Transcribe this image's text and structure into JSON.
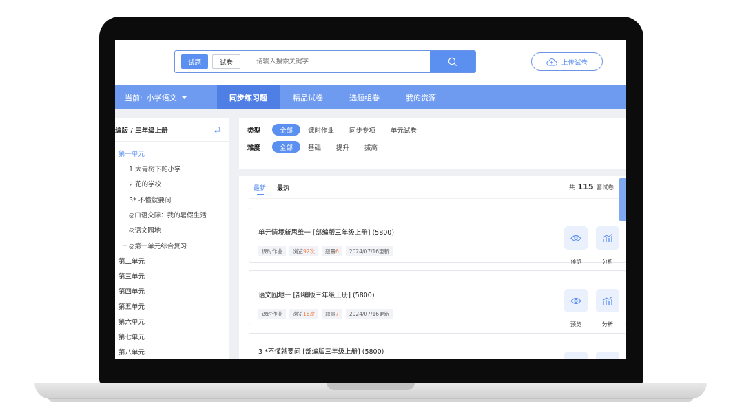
{
  "header": {
    "tabs": [
      {
        "label": "试题",
        "active": true
      },
      {
        "label": "试卷",
        "active": false
      }
    ],
    "search_placeholder": "请输入搜索关键字",
    "upload_label": "上传试卷"
  },
  "nav": {
    "current_prefix": "当前:",
    "current_subject": "小学语文",
    "tabs": [
      {
        "label": "同步练习题",
        "active": true
      },
      {
        "label": "精品试卷",
        "active": false
      },
      {
        "label": "选题组卷",
        "active": false
      },
      {
        "label": "我的资源",
        "active": false
      }
    ]
  },
  "sidebar": {
    "heading": "编版 / 三年级上册",
    "active_unit": "第一单元",
    "lessons": [
      "1 大青树下的小学",
      "2 花的学校",
      "3* 不懂就要问",
      "◎口语交际：我的暑假生活",
      "◎语文园地",
      "◎第一单元综合复习"
    ],
    "units": [
      "第二单元",
      "第三单元",
      "第四单元",
      "第五单元",
      "第六单元",
      "第七单元",
      "第八单元"
    ]
  },
  "filters": {
    "type_label": "类型",
    "types": [
      {
        "label": "全部",
        "active": true
      },
      {
        "label": "课时作业",
        "active": false
      },
      {
        "label": "同步专项",
        "active": false
      },
      {
        "label": "单元试卷",
        "active": false
      }
    ],
    "difficulty_label": "难度",
    "difficulties": [
      {
        "label": "全部",
        "active": true
      },
      {
        "label": "基础",
        "active": false
      },
      {
        "label": "提升",
        "active": false
      },
      {
        "label": "拔高",
        "active": false
      }
    ]
  },
  "results": {
    "sort_tabs": [
      {
        "label": "最新",
        "active": true
      },
      {
        "label": "最热",
        "active": false
      }
    ],
    "total_prefix": "共",
    "total_count": "115",
    "total_suffix": "套试卷",
    "preview_label": "预览",
    "analysis_label": "分析",
    "items": [
      {
        "title": "单元情境新思维一 [部编版三年级上册] (5800)",
        "tag_type": "课时作业",
        "views_prefix": "浏览",
        "views": "92次",
        "count_prefix": "题量",
        "count": "6",
        "date": "2024/07/16更新"
      },
      {
        "title": "语文园地一 [部编版三年级上册] (5800)",
        "tag_type": "课时作业",
        "views_prefix": "浏览",
        "views": "16次",
        "count_prefix": "题量",
        "count": "7",
        "date": "2024/07/16更新"
      },
      {
        "title": "3 *不懂就要问 [部编版三年级上册] (5800)"
      }
    ]
  },
  "colors": {
    "accent": "#5b8ff0",
    "nav": "#6e9bf0",
    "highlight": "#ef7b45"
  }
}
